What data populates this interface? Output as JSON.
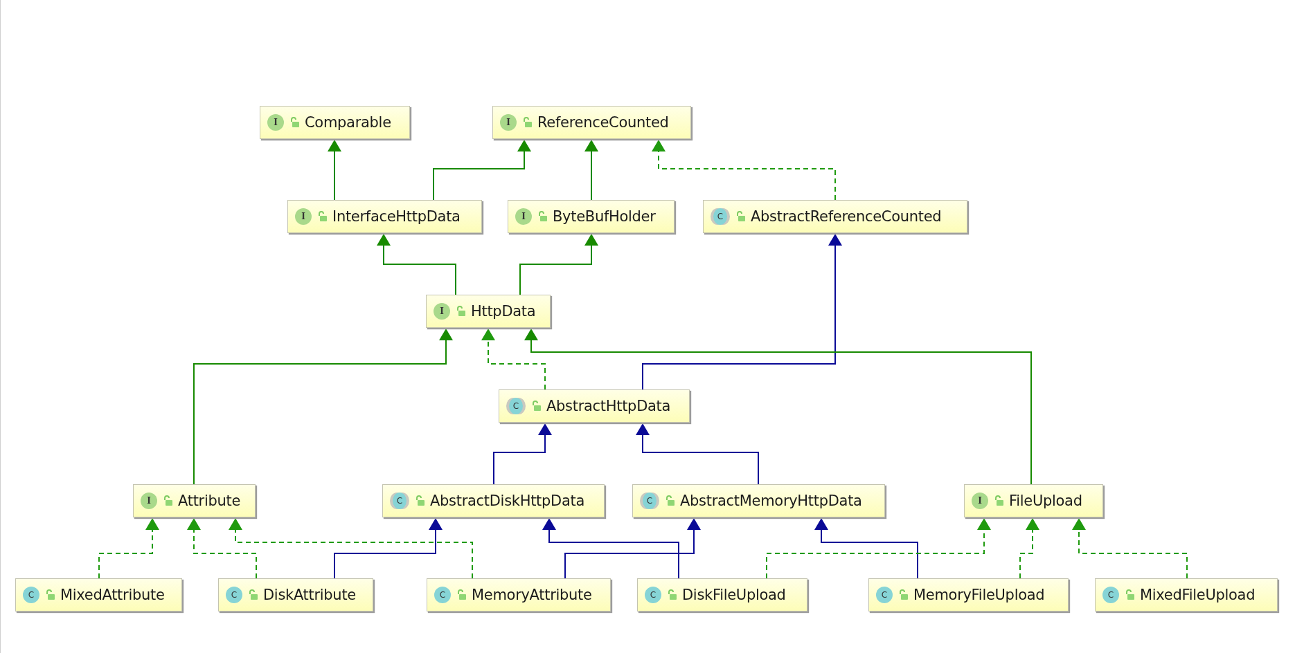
{
  "diagram": {
    "nodes": [
      {
        "name": "Comparable",
        "kind": "interface",
        "badge": "I"
      },
      {
        "name": "ReferenceCounted",
        "kind": "interface",
        "badge": "I"
      },
      {
        "name": "InterfaceHttpData",
        "kind": "interface",
        "badge": "I"
      },
      {
        "name": "ByteBufHolder",
        "kind": "interface",
        "badge": "I"
      },
      {
        "name": "AbstractReferenceCounted",
        "kind": "abstract",
        "badge": "C"
      },
      {
        "name": "HttpData",
        "kind": "interface",
        "badge": "I"
      },
      {
        "name": "AbstractHttpData",
        "kind": "abstract",
        "badge": "C"
      },
      {
        "name": "Attribute",
        "kind": "interface",
        "badge": "I"
      },
      {
        "name": "AbstractDiskHttpData",
        "kind": "abstract",
        "badge": "C"
      },
      {
        "name": "AbstractMemoryHttpData",
        "kind": "abstract",
        "badge": "C"
      },
      {
        "name": "FileUpload",
        "kind": "interface",
        "badge": "I"
      },
      {
        "name": "MixedAttribute",
        "kind": "class",
        "badge": "C"
      },
      {
        "name": "DiskAttribute",
        "kind": "class",
        "badge": "C"
      },
      {
        "name": "MemoryAttribute",
        "kind": "class",
        "badge": "C"
      },
      {
        "name": "DiskFileUpload",
        "kind": "class",
        "badge": "C"
      },
      {
        "name": "MemoryFileUpload",
        "kind": "class",
        "badge": "C"
      },
      {
        "name": "MixedFileUpload",
        "kind": "class",
        "badge": "C"
      }
    ],
    "edges": [
      {
        "kind": "interface-extends"
      },
      {
        "kind": "interface-extends"
      },
      {
        "kind": "interface-extends"
      },
      {
        "kind": "implements"
      },
      {
        "kind": "interface-extends"
      },
      {
        "kind": "interface-extends"
      },
      {
        "kind": "extends"
      },
      {
        "kind": "interface-extends"
      },
      {
        "kind": "implements"
      },
      {
        "kind": "interface-extends"
      },
      {
        "kind": "extends"
      },
      {
        "kind": "extends"
      },
      {
        "kind": "implements"
      },
      {
        "kind": "implements"
      },
      {
        "kind": "implements"
      },
      {
        "kind": "extends"
      },
      {
        "kind": "extends"
      },
      {
        "kind": "extends"
      },
      {
        "kind": "extends"
      },
      {
        "kind": "implements"
      },
      {
        "kind": "implements"
      },
      {
        "kind": "implements"
      }
    ]
  }
}
